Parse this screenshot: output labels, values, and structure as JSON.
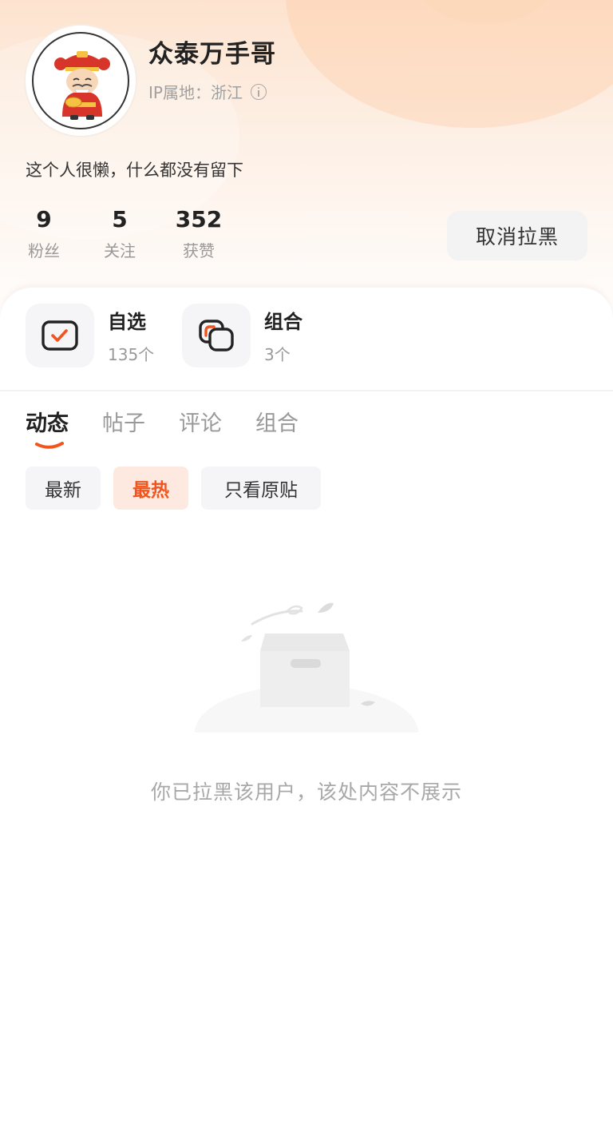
{
  "profile": {
    "name": "众泰万手哥",
    "ip_label": "IP属地：浙江",
    "bio": "这个人很懒，什么都没有留下",
    "avatar_icon": "fortune-god-avatar",
    "stats": [
      {
        "value": "9",
        "label": "粉丝"
      },
      {
        "value": "5",
        "label": "关注"
      },
      {
        "value": "352",
        "label": "获赞"
      }
    ],
    "unblock_button": "取消拉黑"
  },
  "shortcuts": [
    {
      "title": "自选",
      "sub": "135个",
      "icon": "checkbox-icon"
    },
    {
      "title": "组合",
      "sub": "3个",
      "icon": "stacked-squares-icon"
    }
  ],
  "tabs": [
    {
      "label": "动态",
      "active": true
    },
    {
      "label": "帖子",
      "active": false
    },
    {
      "label": "评论",
      "active": false
    },
    {
      "label": "组合",
      "active": false
    }
  ],
  "filters": [
    {
      "label": "最新",
      "active": false
    },
    {
      "label": "最热",
      "active": true
    },
    {
      "label": "只看原贴",
      "active": false
    }
  ],
  "empty_state": {
    "icon": "empty-box-icon",
    "message": "你已拉黑该用户，该处内容不展示"
  },
  "colors": {
    "accent": "#f1551f",
    "chip_active_bg": "#fde9df",
    "header_gradient_top": "#fde3cf"
  }
}
